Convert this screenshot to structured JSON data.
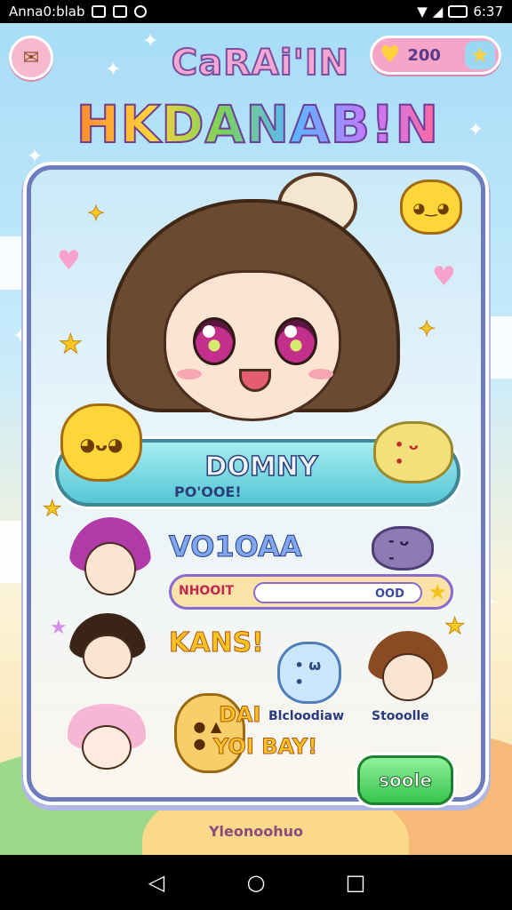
{
  "status_bar": {
    "app_label": "Anna0:blab",
    "time": "6:37",
    "icons": [
      "notification-icon",
      "image-icon",
      "sync-icon",
      "wifi-icon",
      "signal-icon",
      "battery-icon"
    ]
  },
  "header": {
    "logo_top": "CaRAi'IN",
    "logo_main": "HKDANAB!N",
    "coins": "200",
    "settings_icon": "settings-icon",
    "add_icon": "star-icon"
  },
  "character": {
    "name": "DOMNY",
    "subtitle": "PO'OOE!"
  },
  "rows": {
    "row1_title": "VO1OAA",
    "progress_label": "NHOOIT",
    "progress_value": "OOD",
    "progress_fraction": 0.0,
    "row2_title": "KANS!",
    "pet1_label": "Blcloodiaw",
    "pet2_label": "Stooolle",
    "bottom_text_1": "DAI",
    "bottom_text_2": "YOI BAY!",
    "go_button": "soole"
  },
  "footer": {
    "text": "Yleonoohuo"
  },
  "colors": {
    "card_border": "#6f7bbf",
    "banner": "#56c6d6",
    "go_button": "#37c44c",
    "coin_pill": "#f6a5c8"
  },
  "navbar": {
    "back": "◁",
    "home": "○",
    "recent": "□"
  }
}
